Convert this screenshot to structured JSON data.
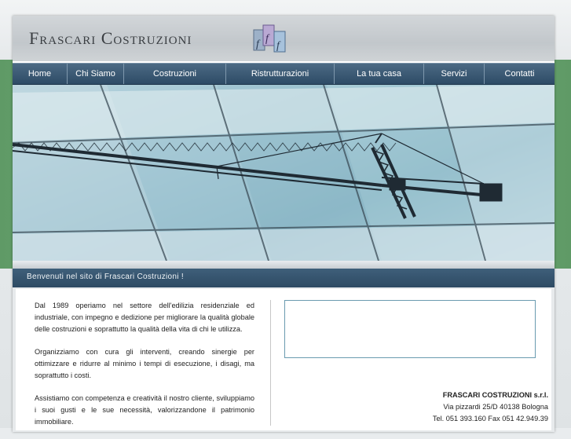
{
  "site": {
    "logo_text": "Frascari Costruzioni",
    "logo_mark_letters": [
      "f",
      "f",
      "f"
    ]
  },
  "nav": {
    "items": [
      {
        "label": "Home"
      },
      {
        "label": "Chi Siamo"
      },
      {
        "label": "Costruzioni"
      },
      {
        "label": "Ristrutturazioni"
      },
      {
        "label": "La tua casa"
      },
      {
        "label": "Servizi"
      },
      {
        "label": "Contatti"
      }
    ]
  },
  "welcome": {
    "text": "Benvenuti nel sito di Frascari Costruzioni !"
  },
  "intro": {
    "paragraphs": [
      "Dal 1989 operiamo nel settore dell'edilizia residenziale ed industriale, con impegno e dedizione per migliorare la qualità globale delle costruzioni e soprattutto la qualità della vita di chi le utilizza.",
      "Organizziamo con cura gli interventi, creando sinergie per ottimizzare e ridurre al minimo i tempi di esecuzione, i disagi, ma soprattutto i costi.",
      "Assistiamo con competenza e creatività il nostro cliente, sviluppiamo i suoi gusti e le sue necessità, valorizzandone il patrimonio immobiliare."
    ]
  },
  "company": {
    "name": "FRASCARI COSTRUZIONI s.r.l.",
    "address": "Via pizzardi 25/D 40138 Bologna",
    "phone_fax": "Tel. 051 393.160 Fax 051 42.949.39"
  },
  "colors": {
    "nav": "#2d4b66",
    "green_band": "#6aa672",
    "accent_border": "#6a9bb0"
  }
}
